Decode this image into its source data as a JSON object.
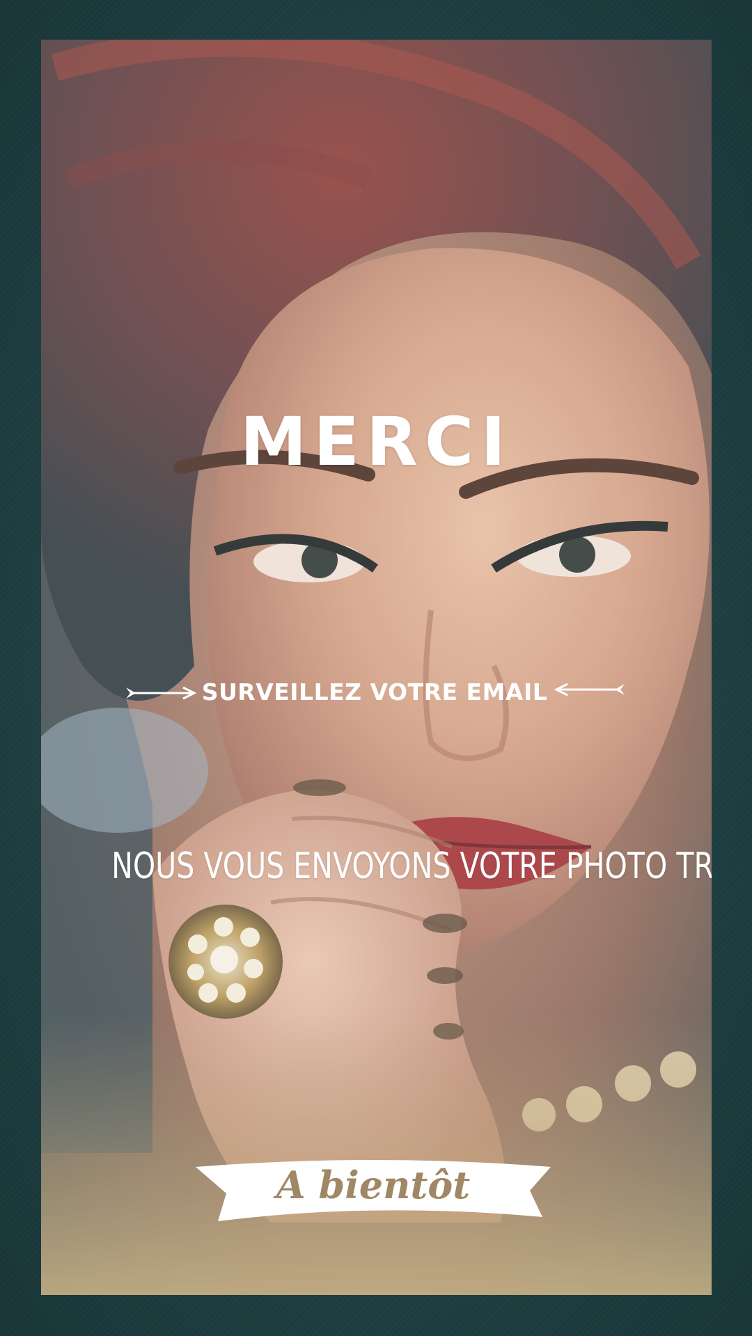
{
  "main": {
    "title": "MERCI",
    "email_prompt": "SURVEILLEZ VOTRE EMAIL",
    "message": "NOUS VOUS ENVOYONS VOTRE PHOTO TRÈS VITE !"
  },
  "ribbon": {
    "label": "A bientôt"
  },
  "icons": {
    "left_arrow": "arrow-right-icon",
    "right_arrow": "arrow-left-icon"
  },
  "colors": {
    "background": "#24484b",
    "text": "#ffffff",
    "ribbon_fill": "#ffffff",
    "ribbon_text": "#a08866"
  }
}
